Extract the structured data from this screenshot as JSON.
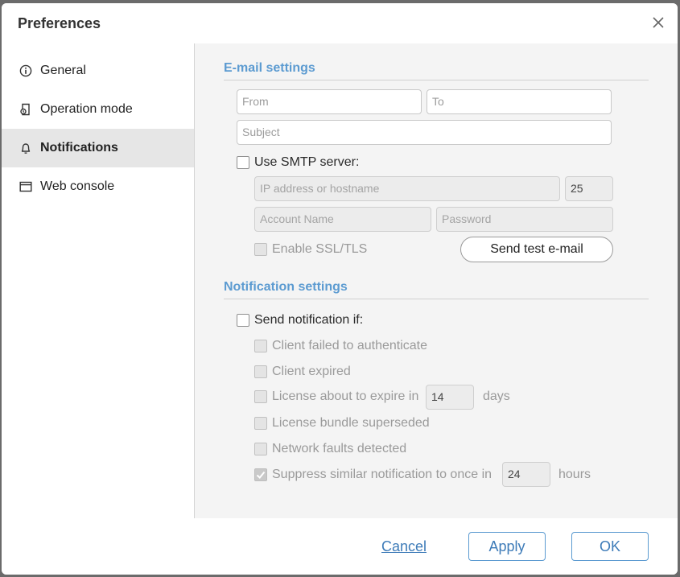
{
  "dialog": {
    "title": "Preferences",
    "close_icon": "close-icon"
  },
  "sidebar": {
    "items": [
      {
        "label": "General",
        "icon": "info-circle-icon"
      },
      {
        "label": "Operation mode",
        "icon": "mode-icon"
      },
      {
        "label": "Notifications",
        "icon": "bell-icon",
        "active": true
      },
      {
        "label": "Web console",
        "icon": "browser-window-icon"
      }
    ]
  },
  "email": {
    "section_title": "E-mail settings",
    "from_placeholder": "From",
    "to_placeholder": "To",
    "subject_placeholder": "Subject",
    "use_smtp_label": "Use SMTP server:",
    "host_placeholder": "IP address or hostname",
    "port_value": "25",
    "account_placeholder": "Account Name",
    "password_placeholder": "Password",
    "ssl_label": "Enable SSL/TLS",
    "send_test_label": "Send test e-mail"
  },
  "notification": {
    "section_title": "Notification settings",
    "send_if_label": "Send notification if:",
    "client_failed_label": "Client failed to authenticate",
    "client_expired_label": "Client expired",
    "license_expire_label": "License about to expire in",
    "license_expire_days": "14",
    "days_unit": "days",
    "bundle_superseded_label": "License bundle superseded",
    "network_faults_label": "Network faults detected",
    "suppress_label": "Suppress similar notification to once in",
    "suppress_hours": "24",
    "hours_unit": "hours"
  },
  "footer": {
    "cancel_label": "Cancel",
    "apply_label": "Apply",
    "ok_label": "OK"
  },
  "colors": {
    "accent": "#5c9bd1",
    "link": "#3d7bb8"
  }
}
